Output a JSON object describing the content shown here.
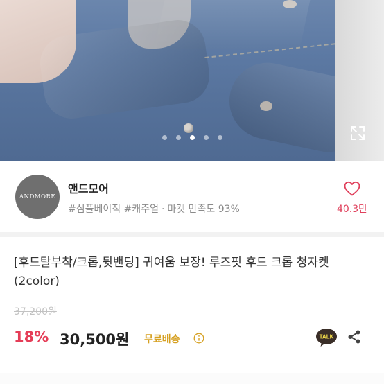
{
  "gallery": {
    "slide_count": 5,
    "active_slide": 3,
    "colors": {
      "dot_active": "#ffffff",
      "dot_inactive": "rgba(255,255,255,0.55)"
    }
  },
  "seller": {
    "logo_text": "ANDMORE",
    "name": "앤드모어",
    "tags": "#심플베이직 #캐주얼",
    "satisfaction": "마켓 만족도 93%",
    "separator": "·"
  },
  "like": {
    "count": "40.3만",
    "color": "#e0405c"
  },
  "product": {
    "title": "[후드탈부착/크롭,뒷밴딩] 귀여움 보장! 루즈핏 후드 크롭 청자켓 (2color)",
    "original_price": "37,200원",
    "discount": "18%",
    "price": "30,500원",
    "shipping": "무료배송"
  },
  "icons": {
    "expand": "expand-icon",
    "heart": "heart-icon",
    "info": "info-icon",
    "talk": "kakao-talk-icon",
    "share": "share-icon"
  },
  "colors": {
    "accent": "#e53d57",
    "shipping": "#d6a021",
    "talk_bg": "#3a2e28"
  }
}
